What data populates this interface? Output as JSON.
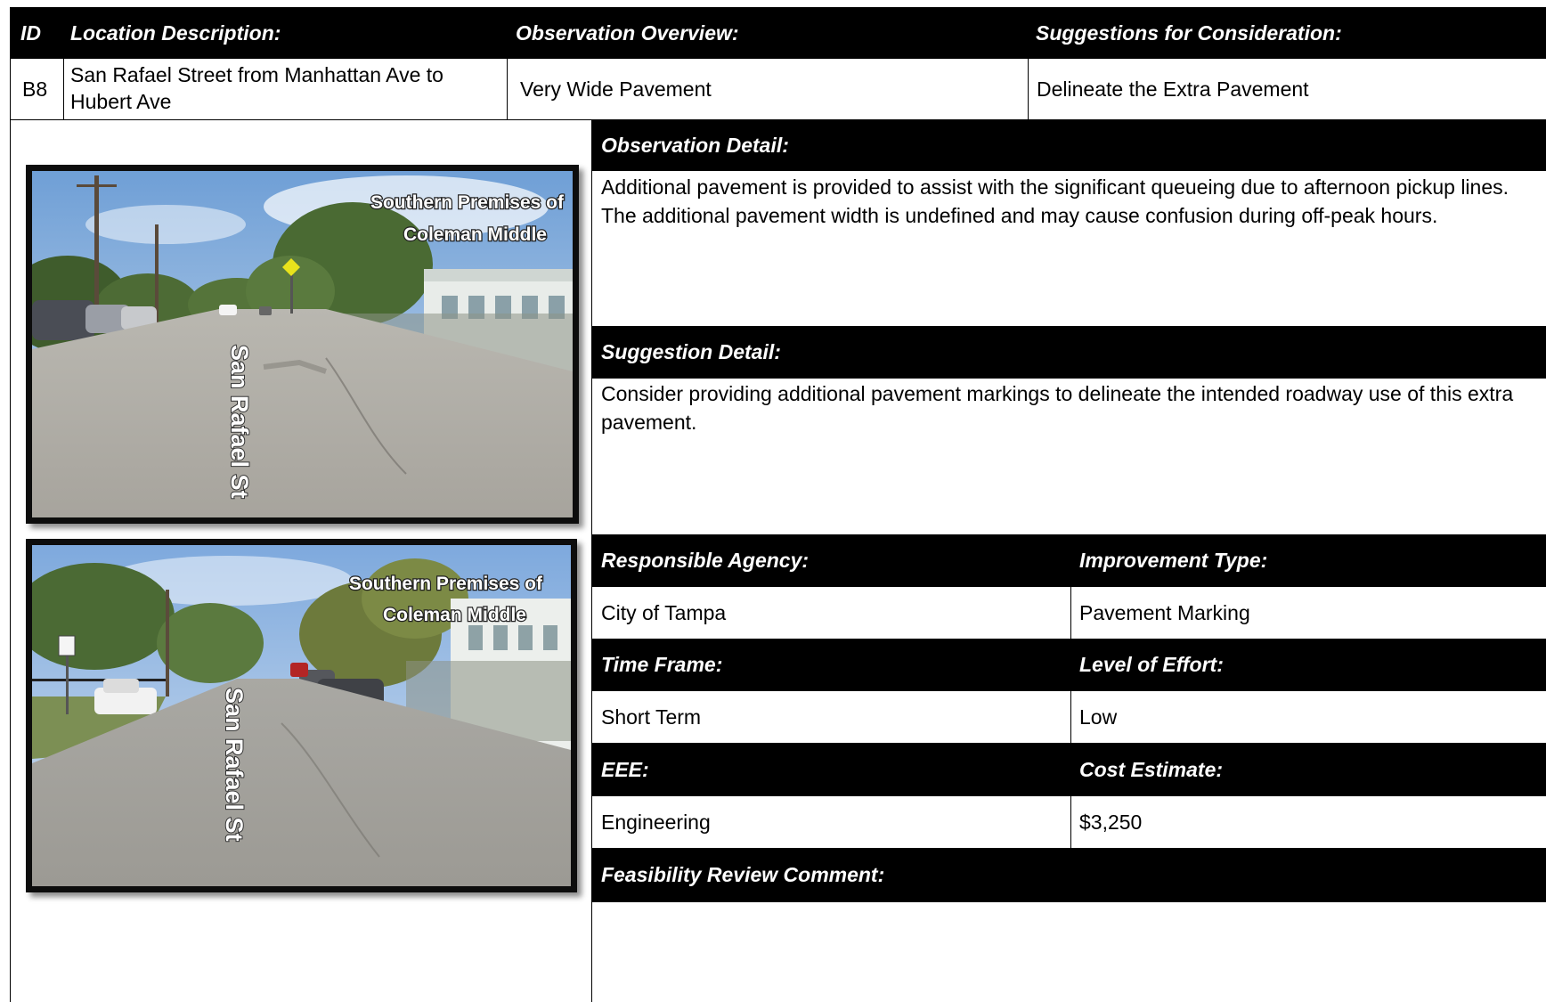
{
  "header": {
    "id_label": "ID",
    "location_label": "Location Description:",
    "observation_label": "Observation Overview:",
    "suggestions_label": "Suggestions for Consideration:"
  },
  "row": {
    "id": "B8",
    "location": "San Rafael Street from Manhattan Ave to Hubert Ave",
    "observation": "Very Wide Pavement",
    "suggestion": "Delineate the Extra Pavement"
  },
  "observation_detail": {
    "label": "Observation Detail:",
    "text": "Additional pavement is provided to assist with the significant queueing due to afternoon pickup lines. The additional pavement width is undefined and may cause confusion during off-peak hours."
  },
  "suggestion_detail": {
    "label": "Suggestion Detail:",
    "text": "Consider providing additional pavement markings to delineate the intended roadway use of this extra pavement."
  },
  "details": {
    "responsible_agency_label": "Responsible Agency:",
    "responsible_agency": "City of Tampa",
    "improvement_type_label": "Improvement Type:",
    "improvement_type": "Pavement Marking",
    "time_frame_label": "Time Frame:",
    "time_frame": "Short Term",
    "level_of_effort_label": "Level of Effort:",
    "level_of_effort": "Low",
    "eee_label": "EEE:",
    "eee": "Engineering",
    "cost_estimate_label": "Cost Estimate:",
    "cost_estimate": "$3,250",
    "feasibility_label": "Feasibility Review Comment:"
  },
  "photos": {
    "photo1": {
      "street": "San Rafael St",
      "premises_line1": "Southern Premises of",
      "premises_line2": "Coleman Middle"
    },
    "photo2": {
      "street": "San Rafael St",
      "premises_line1": "Southern Premises of",
      "premises_line2": "Coleman Middle"
    }
  }
}
